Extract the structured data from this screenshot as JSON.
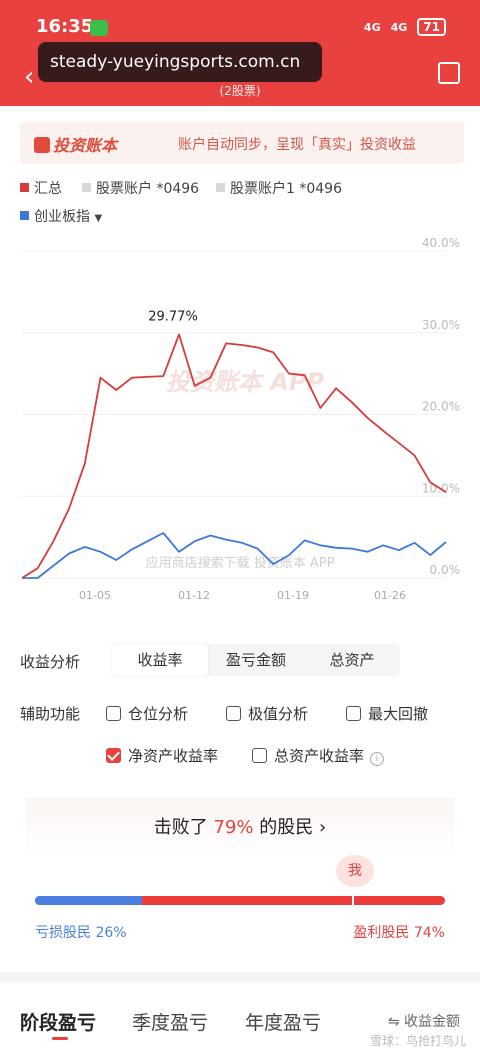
{
  "status": {
    "time": "16:35",
    "battery": "71",
    "signal": "4G"
  },
  "header": {
    "subtitle": "(2股票)",
    "back_icon": "chevron-left-icon",
    "share_icon": "share-icon"
  },
  "overlay": {
    "url": "steady-yueyingsports.com.cn"
  },
  "banner": {
    "brand": "投资账本",
    "slogan": "账户自动同步，呈现「真实」投资收益"
  },
  "legend": {
    "items": [
      {
        "label": "汇总",
        "color": "#d93a3a"
      },
      {
        "label": "股票账户 *0496",
        "color": "#d8d8d8"
      },
      {
        "label": "股票账户1 *0496",
        "color": "#d8d8d8"
      },
      {
        "label": "创业板指",
        "color": "#3c78d8"
      }
    ]
  },
  "chart_data": {
    "type": "line",
    "y_tick_labels": [
      "40.0%",
      "30.0%",
      "20.0%",
      "10.0%",
      "0.0%"
    ],
    "ylim": [
      0,
      40
    ],
    "x_tick_labels": [
      "01-05",
      "01-12",
      "01-19",
      "01-26"
    ],
    "annotation": "29.77%",
    "watermark_center": "投资账本 APP",
    "watermark_bottom": "应用商店搜索下载 投资账本 APP",
    "series": [
      {
        "name": "汇总",
        "color": "#d93a3a",
        "values": [
          0,
          1.2,
          4.5,
          8.5,
          14,
          24.5,
          23,
          24.5,
          24.6,
          24.7,
          29.8,
          23.5,
          24.5,
          28.7,
          28.5,
          28.2,
          27.6,
          25,
          24.8,
          20.8,
          23.2,
          21.5,
          19.6,
          18,
          16.5,
          15,
          11.7,
          10.5
        ]
      },
      {
        "name": "创业板指",
        "color": "#3c78d8",
        "values": [
          0,
          0,
          1.5,
          3,
          3.8,
          3.2,
          2.2,
          3.5,
          4.5,
          5.5,
          3.2,
          4.5,
          5.2,
          4.7,
          4.3,
          3.6,
          1.7,
          2.8,
          4.6,
          4.0,
          3.7,
          3.6,
          3.2,
          4.0,
          3.4,
          4.3,
          2.8,
          4.4
        ]
      }
    ]
  },
  "analysis": {
    "label": "收益分析",
    "tabs": [
      "收益率",
      "盈亏金额",
      "总资产"
    ]
  },
  "aux": {
    "label": "辅助功能",
    "options": [
      {
        "label": "仓位分析",
        "checked": false
      },
      {
        "label": "极值分析",
        "checked": false
      },
      {
        "label": "最大回撤",
        "checked": false
      },
      {
        "label": "净资产收益率",
        "checked": true
      },
      {
        "label": "总资产收益率",
        "checked": false
      }
    ],
    "info_symbol": "i"
  },
  "beat": {
    "prefix": "击败了",
    "pct": "79%",
    "suffix": "的股民",
    "arrow": "›"
  },
  "ratio": {
    "me": "我",
    "loss": "亏损股民 26%",
    "gain": "盈利股民 74%",
    "loss_fraction": 0.26
  },
  "bottom": {
    "tabs": [
      "阶段盈亏",
      "季度盈亏",
      "年度盈亏"
    ],
    "amount": "⇋ 收益金额",
    "watermark": "雪球：鸟抢打鸟儿"
  }
}
